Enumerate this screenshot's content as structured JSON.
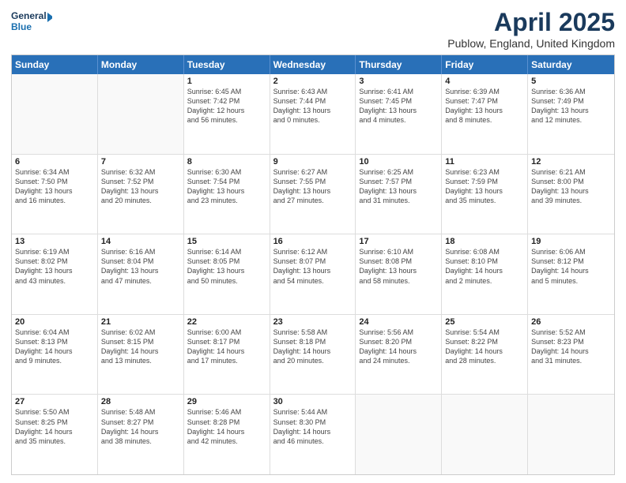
{
  "logo": {
    "line1": "General",
    "line2": "Blue"
  },
  "title": "April 2025",
  "subtitle": "Publow, England, United Kingdom",
  "headers": [
    "Sunday",
    "Monday",
    "Tuesday",
    "Wednesday",
    "Thursday",
    "Friday",
    "Saturday"
  ],
  "weeks": [
    [
      {
        "day": "",
        "lines": []
      },
      {
        "day": "",
        "lines": []
      },
      {
        "day": "1",
        "lines": [
          "Sunrise: 6:45 AM",
          "Sunset: 7:42 PM",
          "Daylight: 12 hours",
          "and 56 minutes."
        ]
      },
      {
        "day": "2",
        "lines": [
          "Sunrise: 6:43 AM",
          "Sunset: 7:44 PM",
          "Daylight: 13 hours",
          "and 0 minutes."
        ]
      },
      {
        "day": "3",
        "lines": [
          "Sunrise: 6:41 AM",
          "Sunset: 7:45 PM",
          "Daylight: 13 hours",
          "and 4 minutes."
        ]
      },
      {
        "day": "4",
        "lines": [
          "Sunrise: 6:39 AM",
          "Sunset: 7:47 PM",
          "Daylight: 13 hours",
          "and 8 minutes."
        ]
      },
      {
        "day": "5",
        "lines": [
          "Sunrise: 6:36 AM",
          "Sunset: 7:49 PM",
          "Daylight: 13 hours",
          "and 12 minutes."
        ]
      }
    ],
    [
      {
        "day": "6",
        "lines": [
          "Sunrise: 6:34 AM",
          "Sunset: 7:50 PM",
          "Daylight: 13 hours",
          "and 16 minutes."
        ]
      },
      {
        "day": "7",
        "lines": [
          "Sunrise: 6:32 AM",
          "Sunset: 7:52 PM",
          "Daylight: 13 hours",
          "and 20 minutes."
        ]
      },
      {
        "day": "8",
        "lines": [
          "Sunrise: 6:30 AM",
          "Sunset: 7:54 PM",
          "Daylight: 13 hours",
          "and 23 minutes."
        ]
      },
      {
        "day": "9",
        "lines": [
          "Sunrise: 6:27 AM",
          "Sunset: 7:55 PM",
          "Daylight: 13 hours",
          "and 27 minutes."
        ]
      },
      {
        "day": "10",
        "lines": [
          "Sunrise: 6:25 AM",
          "Sunset: 7:57 PM",
          "Daylight: 13 hours",
          "and 31 minutes."
        ]
      },
      {
        "day": "11",
        "lines": [
          "Sunrise: 6:23 AM",
          "Sunset: 7:59 PM",
          "Daylight: 13 hours",
          "and 35 minutes."
        ]
      },
      {
        "day": "12",
        "lines": [
          "Sunrise: 6:21 AM",
          "Sunset: 8:00 PM",
          "Daylight: 13 hours",
          "and 39 minutes."
        ]
      }
    ],
    [
      {
        "day": "13",
        "lines": [
          "Sunrise: 6:19 AM",
          "Sunset: 8:02 PM",
          "Daylight: 13 hours",
          "and 43 minutes."
        ]
      },
      {
        "day": "14",
        "lines": [
          "Sunrise: 6:16 AM",
          "Sunset: 8:04 PM",
          "Daylight: 13 hours",
          "and 47 minutes."
        ]
      },
      {
        "day": "15",
        "lines": [
          "Sunrise: 6:14 AM",
          "Sunset: 8:05 PM",
          "Daylight: 13 hours",
          "and 50 minutes."
        ]
      },
      {
        "day": "16",
        "lines": [
          "Sunrise: 6:12 AM",
          "Sunset: 8:07 PM",
          "Daylight: 13 hours",
          "and 54 minutes."
        ]
      },
      {
        "day": "17",
        "lines": [
          "Sunrise: 6:10 AM",
          "Sunset: 8:08 PM",
          "Daylight: 13 hours",
          "and 58 minutes."
        ]
      },
      {
        "day": "18",
        "lines": [
          "Sunrise: 6:08 AM",
          "Sunset: 8:10 PM",
          "Daylight: 14 hours",
          "and 2 minutes."
        ]
      },
      {
        "day": "19",
        "lines": [
          "Sunrise: 6:06 AM",
          "Sunset: 8:12 PM",
          "Daylight: 14 hours",
          "and 5 minutes."
        ]
      }
    ],
    [
      {
        "day": "20",
        "lines": [
          "Sunrise: 6:04 AM",
          "Sunset: 8:13 PM",
          "Daylight: 14 hours",
          "and 9 minutes."
        ]
      },
      {
        "day": "21",
        "lines": [
          "Sunrise: 6:02 AM",
          "Sunset: 8:15 PM",
          "Daylight: 14 hours",
          "and 13 minutes."
        ]
      },
      {
        "day": "22",
        "lines": [
          "Sunrise: 6:00 AM",
          "Sunset: 8:17 PM",
          "Daylight: 14 hours",
          "and 17 minutes."
        ]
      },
      {
        "day": "23",
        "lines": [
          "Sunrise: 5:58 AM",
          "Sunset: 8:18 PM",
          "Daylight: 14 hours",
          "and 20 minutes."
        ]
      },
      {
        "day": "24",
        "lines": [
          "Sunrise: 5:56 AM",
          "Sunset: 8:20 PM",
          "Daylight: 14 hours",
          "and 24 minutes."
        ]
      },
      {
        "day": "25",
        "lines": [
          "Sunrise: 5:54 AM",
          "Sunset: 8:22 PM",
          "Daylight: 14 hours",
          "and 28 minutes."
        ]
      },
      {
        "day": "26",
        "lines": [
          "Sunrise: 5:52 AM",
          "Sunset: 8:23 PM",
          "Daylight: 14 hours",
          "and 31 minutes."
        ]
      }
    ],
    [
      {
        "day": "27",
        "lines": [
          "Sunrise: 5:50 AM",
          "Sunset: 8:25 PM",
          "Daylight: 14 hours",
          "and 35 minutes."
        ]
      },
      {
        "day": "28",
        "lines": [
          "Sunrise: 5:48 AM",
          "Sunset: 8:27 PM",
          "Daylight: 14 hours",
          "and 38 minutes."
        ]
      },
      {
        "day": "29",
        "lines": [
          "Sunrise: 5:46 AM",
          "Sunset: 8:28 PM",
          "Daylight: 14 hours",
          "and 42 minutes."
        ]
      },
      {
        "day": "30",
        "lines": [
          "Sunrise: 5:44 AM",
          "Sunset: 8:30 PM",
          "Daylight: 14 hours",
          "and 46 minutes."
        ]
      },
      {
        "day": "",
        "lines": []
      },
      {
        "day": "",
        "lines": []
      },
      {
        "day": "",
        "lines": []
      }
    ]
  ]
}
